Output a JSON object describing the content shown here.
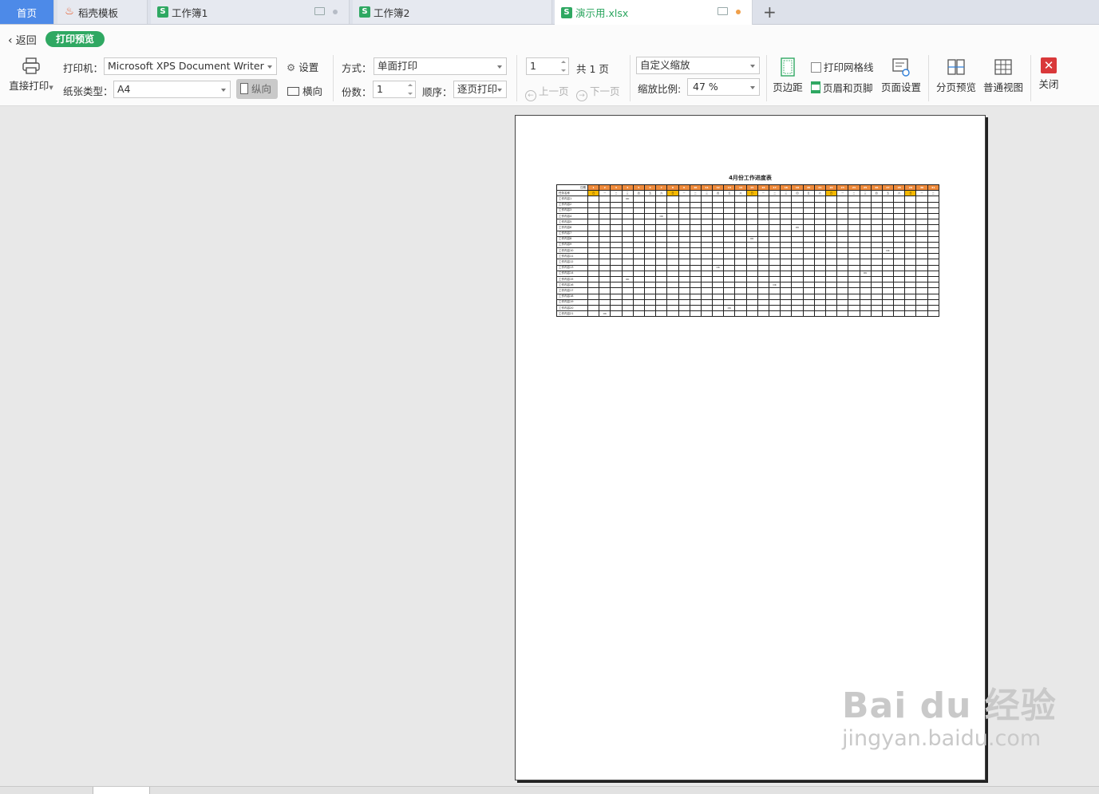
{
  "tabs": [
    {
      "label": "首页"
    },
    {
      "label": "稻壳模板",
      "icon": "fire-icon"
    },
    {
      "label": "工作簿1",
      "icon": "spreadsheet-icon"
    },
    {
      "label": "工作簿2",
      "icon": "spreadsheet-icon"
    },
    {
      "label": "演示用.xlsx",
      "icon": "spreadsheet-icon"
    }
  ],
  "new_tab_label": "+",
  "toolbar": {
    "back_label": "返回",
    "mode_badge": "打印预览",
    "direct_print_label": "直接打印",
    "printer_label": "打印机：",
    "printer_value": "Microsoft XPS Document Writer",
    "settings_label": "设置",
    "paper_label": "纸张类型：",
    "paper_value": "A4",
    "portrait_label": "纵向",
    "landscape_label": "横向",
    "method_label": "方式：",
    "method_value": "单面打印",
    "copies_label": "份数：",
    "copies_value": "1",
    "order_label": "顺序：",
    "order_value": "逐页打印",
    "page_value": "1",
    "total_pages": "共 1 页",
    "prev_page": "上一页",
    "next_page": "下一页",
    "scale_mode": "自定义缩放",
    "scale_label": "缩放比例:",
    "scale_value": "47 %",
    "margins_label": "页边距",
    "gridlines_label": "打印网格线",
    "header_footer_label": "页眉和页脚",
    "page_setup_label": "页面设置",
    "page_break_label": "分页预览",
    "normal_view_label": "普通视图",
    "close_label": "关闭"
  },
  "sheet": {
    "title": "4月份工作进度表",
    "corner_top": "日期",
    "corner_bottom": "任务名称",
    "days": [
      "1",
      "2",
      "3",
      "4",
      "5",
      "6",
      "7",
      "8",
      "9",
      "10",
      "11",
      "12",
      "13",
      "14",
      "15",
      "16",
      "17",
      "18",
      "19",
      "20",
      "21",
      "22",
      "23",
      "24",
      "25",
      "26",
      "27",
      "28",
      "29",
      "30",
      "31"
    ],
    "weekdays": [
      "日",
      "一",
      "二",
      "三",
      "四",
      "五",
      "六",
      "日",
      "一",
      "二",
      "三",
      "四",
      "五",
      "六",
      "日",
      "一",
      "二",
      "三",
      "四",
      "五",
      "六",
      "日",
      "一",
      "二",
      "三",
      "四",
      "五",
      "六",
      "日",
      "一",
      "二"
    ],
    "highlight_weekdays": [
      0,
      7,
      14,
      21,
      28
    ],
    "rows": [
      "工作内容1",
      "工作内容2",
      "工作内容3",
      "工作内容4",
      "工作内容5",
      "工作内容6",
      "工作内容7",
      "工作内容8",
      "工作内容9",
      "工作内容10",
      "工作内容11",
      "工作内容12",
      "工作内容13",
      "工作内容14",
      "工作内容15",
      "工作内容16",
      "工作内容17",
      "工作内容18",
      "工作内容19",
      "工作内容20",
      "工作内容21"
    ],
    "done_mark": "OK",
    "done_cells": [
      [
        1,
        4
      ],
      [
        4,
        7
      ],
      [
        6,
        19
      ],
      [
        8,
        15
      ],
      [
        10,
        27
      ],
      [
        13,
        12
      ],
      [
        14,
        25
      ],
      [
        15,
        4
      ],
      [
        16,
        17
      ],
      [
        20,
        13
      ],
      [
        21,
        2
      ]
    ]
  },
  "watermark": {
    "line1": "Bai du 经验",
    "line2": "jingyan.baidu.com"
  }
}
